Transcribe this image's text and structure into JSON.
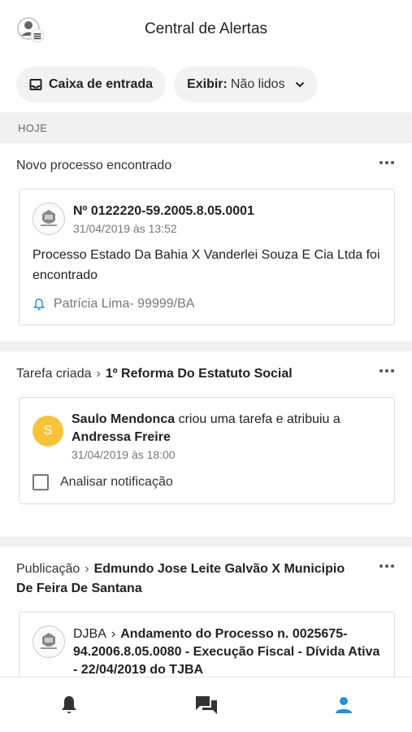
{
  "header": {
    "title": "Central de Alertas"
  },
  "filters": {
    "inbox_label": "Caixa de entrada",
    "show_label": "Exibir:",
    "show_value": "Não lidos"
  },
  "section": {
    "label": "HOJE"
  },
  "groups": [
    {
      "title": "Novo processo encontrado",
      "card": {
        "number": "Nº 0122220-59.2005.8.05.0001",
        "date": "31/04/2019 às 13:52",
        "body": "Processo Estado Da Bahia X Vanderlei Souza E Cia Ltda foi encontrado",
        "owner": "Patrícia Lima- 99999/BA"
      }
    },
    {
      "title_prefix": "Tarefa criada",
      "title_bold": "1º Reforma Do Estatuto Social",
      "card": {
        "initial": "S",
        "actor": "Saulo Mendonca",
        "action": " criou uma tarefa e atribuiu a ",
        "target": "Andressa Freire",
        "date": "31/04/2019 às 18:00",
        "task": "Analisar notificação"
      }
    },
    {
      "title_prefix": "Publicação",
      "title_bold": "Edmundo Jose Leite Galvão X Municipio De Feira De Santana",
      "card": {
        "source": "DJBA",
        "text": "Andamento do Processo n. 0025675-94.2006.8.05.0080 - Execução Fiscal - Dívida Ativa - 22/04/2019 do TJBA"
      }
    }
  ],
  "colors": {
    "accent": "#2a8fd8",
    "initial_badge": "#f6c33b"
  },
  "bottom_nav": {
    "items": [
      "bell-icon",
      "chat-icon",
      "person-icon"
    ],
    "active": "person-icon"
  }
}
